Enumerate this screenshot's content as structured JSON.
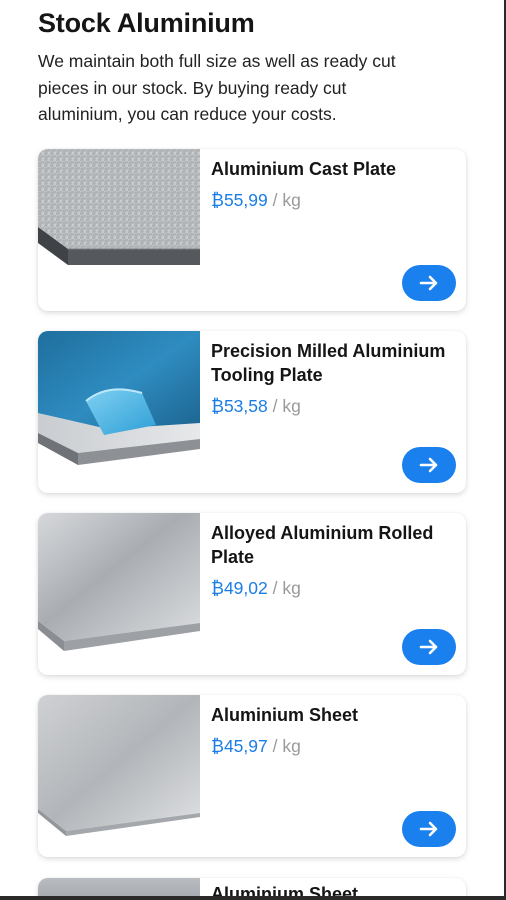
{
  "page": {
    "title": "Stock Aluminium",
    "intro_lines": [
      "We maintain both full size as well as ready cut",
      "pieces in our stock. By buying ready cut",
      "aluminium, you can reduce your costs."
    ]
  },
  "products": [
    {
      "name_lines": [
        "Aluminium Cast Plate"
      ],
      "price": "₿55,99",
      "unit": "/ kg",
      "image": "cast-plate-image",
      "button_icon": "arrow-right-icon"
    },
    {
      "name_lines": [
        "Precision Milled Aluminium",
        "Tooling Plate"
      ],
      "price": "₿53,58",
      "unit": "/ kg",
      "image": "tooling-plate-image",
      "button_icon": "arrow-right-icon"
    },
    {
      "name_lines": [
        "Alloyed Aluminium Rolled",
        "Plate"
      ],
      "price": "₿49,02",
      "unit": "/ kg",
      "image": "rolled-plate-image",
      "button_icon": "arrow-right-icon"
    },
    {
      "name_lines": [
        "Aluminium Sheet"
      ],
      "price": "₿45,97",
      "unit": "/ kg",
      "image": "sheet-image",
      "button_icon": "arrow-right-icon"
    }
  ],
  "partial_product": {
    "name": "Aluminium Sheet"
  },
  "colors": {
    "accent": "#1a80ee",
    "price": "#1a7de6",
    "unit": "#9a9a9a"
  }
}
